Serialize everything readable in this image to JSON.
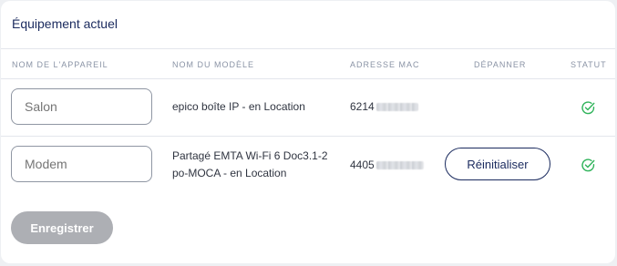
{
  "section": {
    "title": "Équipement actuel"
  },
  "table": {
    "headers": {
      "device_name": "NOM DE L'APPAREIL",
      "model_name": "NOM DU MODÈLE",
      "mac_address": "ADRESSE MAC",
      "troubleshoot": "DÉPANNER",
      "status": "STATUT"
    },
    "rows": [
      {
        "device_name_placeholder": "Salon",
        "model_name": "epico boîte IP - en Location",
        "mac_prefix": "6214",
        "troubleshoot_label": "",
        "status": "ok",
        "status_icon": "check-circle-icon"
      },
      {
        "device_name_placeholder": "Modem",
        "model_name_line1": "Partagé EMTA Wi-Fi 6 Doc3.1-2",
        "model_name_line2": "po-MOCA - en Location",
        "mac_prefix": "4405",
        "troubleshoot_label": "Réinitialiser",
        "status": "ok",
        "status_icon": "check-circle-icon"
      }
    ]
  },
  "actions": {
    "save_label": "Enregistrer"
  },
  "colors": {
    "primary": "#1a2a5e",
    "status_ok": "#2fb35a",
    "disabled_button": "#adafb4"
  }
}
